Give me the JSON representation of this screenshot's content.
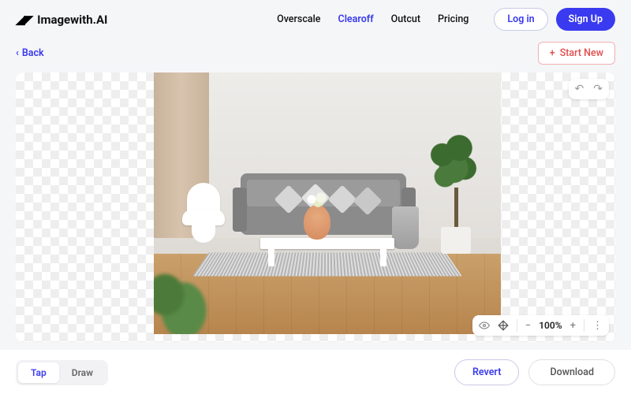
{
  "header": {
    "logo_text": "Imagewith.AI",
    "nav": {
      "overscale": "Overscale",
      "clearoff": "Clearoff",
      "outcut": "Outcut",
      "pricing": "Pricing"
    },
    "login": "Log in",
    "signup": "Sign Up"
  },
  "subbar": {
    "back": "Back",
    "start_new": "Start New"
  },
  "zoom": {
    "level": "100%"
  },
  "footer": {
    "tap": "Tap",
    "draw": "Draw",
    "revert": "Revert",
    "download": "Download"
  }
}
